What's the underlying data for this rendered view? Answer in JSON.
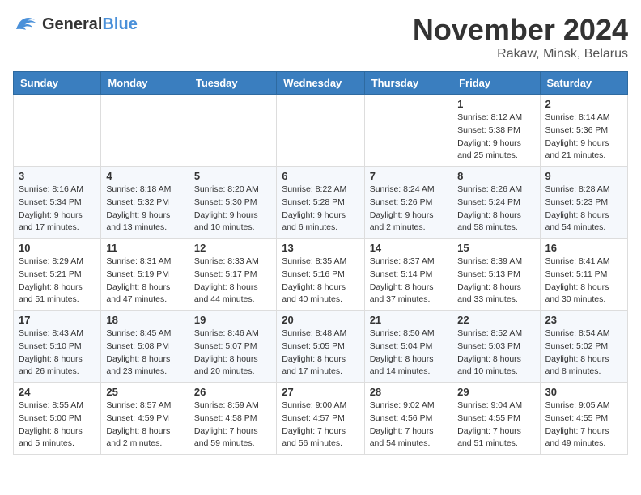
{
  "logo": {
    "text_general": "General",
    "text_blue": "Blue"
  },
  "title": "November 2024",
  "location": "Rakaw, Minsk, Belarus",
  "days_of_week": [
    "Sunday",
    "Monday",
    "Tuesday",
    "Wednesday",
    "Thursday",
    "Friday",
    "Saturday"
  ],
  "weeks": [
    [
      {
        "day": "",
        "sunrise": "",
        "sunset": "",
        "daylight": ""
      },
      {
        "day": "",
        "sunrise": "",
        "sunset": "",
        "daylight": ""
      },
      {
        "day": "",
        "sunrise": "",
        "sunset": "",
        "daylight": ""
      },
      {
        "day": "",
        "sunrise": "",
        "sunset": "",
        "daylight": ""
      },
      {
        "day": "",
        "sunrise": "",
        "sunset": "",
        "daylight": ""
      },
      {
        "day": "1",
        "sunrise": "Sunrise: 8:12 AM",
        "sunset": "Sunset: 5:38 PM",
        "daylight": "Daylight: 9 hours and 25 minutes."
      },
      {
        "day": "2",
        "sunrise": "Sunrise: 8:14 AM",
        "sunset": "Sunset: 5:36 PM",
        "daylight": "Daylight: 9 hours and 21 minutes."
      }
    ],
    [
      {
        "day": "3",
        "sunrise": "Sunrise: 8:16 AM",
        "sunset": "Sunset: 5:34 PM",
        "daylight": "Daylight: 9 hours and 17 minutes."
      },
      {
        "day": "4",
        "sunrise": "Sunrise: 8:18 AM",
        "sunset": "Sunset: 5:32 PM",
        "daylight": "Daylight: 9 hours and 13 minutes."
      },
      {
        "day": "5",
        "sunrise": "Sunrise: 8:20 AM",
        "sunset": "Sunset: 5:30 PM",
        "daylight": "Daylight: 9 hours and 10 minutes."
      },
      {
        "day": "6",
        "sunrise": "Sunrise: 8:22 AM",
        "sunset": "Sunset: 5:28 PM",
        "daylight": "Daylight: 9 hours and 6 minutes."
      },
      {
        "day": "7",
        "sunrise": "Sunrise: 8:24 AM",
        "sunset": "Sunset: 5:26 PM",
        "daylight": "Daylight: 9 hours and 2 minutes."
      },
      {
        "day": "8",
        "sunrise": "Sunrise: 8:26 AM",
        "sunset": "Sunset: 5:24 PM",
        "daylight": "Daylight: 8 hours and 58 minutes."
      },
      {
        "day": "9",
        "sunrise": "Sunrise: 8:28 AM",
        "sunset": "Sunset: 5:23 PM",
        "daylight": "Daylight: 8 hours and 54 minutes."
      }
    ],
    [
      {
        "day": "10",
        "sunrise": "Sunrise: 8:29 AM",
        "sunset": "Sunset: 5:21 PM",
        "daylight": "Daylight: 8 hours and 51 minutes."
      },
      {
        "day": "11",
        "sunrise": "Sunrise: 8:31 AM",
        "sunset": "Sunset: 5:19 PM",
        "daylight": "Daylight: 8 hours and 47 minutes."
      },
      {
        "day": "12",
        "sunrise": "Sunrise: 8:33 AM",
        "sunset": "Sunset: 5:17 PM",
        "daylight": "Daylight: 8 hours and 44 minutes."
      },
      {
        "day": "13",
        "sunrise": "Sunrise: 8:35 AM",
        "sunset": "Sunset: 5:16 PM",
        "daylight": "Daylight: 8 hours and 40 minutes."
      },
      {
        "day": "14",
        "sunrise": "Sunrise: 8:37 AM",
        "sunset": "Sunset: 5:14 PM",
        "daylight": "Daylight: 8 hours and 37 minutes."
      },
      {
        "day": "15",
        "sunrise": "Sunrise: 8:39 AM",
        "sunset": "Sunset: 5:13 PM",
        "daylight": "Daylight: 8 hours and 33 minutes."
      },
      {
        "day": "16",
        "sunrise": "Sunrise: 8:41 AM",
        "sunset": "Sunset: 5:11 PM",
        "daylight": "Daylight: 8 hours and 30 minutes."
      }
    ],
    [
      {
        "day": "17",
        "sunrise": "Sunrise: 8:43 AM",
        "sunset": "Sunset: 5:10 PM",
        "daylight": "Daylight: 8 hours and 26 minutes."
      },
      {
        "day": "18",
        "sunrise": "Sunrise: 8:45 AM",
        "sunset": "Sunset: 5:08 PM",
        "daylight": "Daylight: 8 hours and 23 minutes."
      },
      {
        "day": "19",
        "sunrise": "Sunrise: 8:46 AM",
        "sunset": "Sunset: 5:07 PM",
        "daylight": "Daylight: 8 hours and 20 minutes."
      },
      {
        "day": "20",
        "sunrise": "Sunrise: 8:48 AM",
        "sunset": "Sunset: 5:05 PM",
        "daylight": "Daylight: 8 hours and 17 minutes."
      },
      {
        "day": "21",
        "sunrise": "Sunrise: 8:50 AM",
        "sunset": "Sunset: 5:04 PM",
        "daylight": "Daylight: 8 hours and 14 minutes."
      },
      {
        "day": "22",
        "sunrise": "Sunrise: 8:52 AM",
        "sunset": "Sunset: 5:03 PM",
        "daylight": "Daylight: 8 hours and 10 minutes."
      },
      {
        "day": "23",
        "sunrise": "Sunrise: 8:54 AM",
        "sunset": "Sunset: 5:02 PM",
        "daylight": "Daylight: 8 hours and 8 minutes."
      }
    ],
    [
      {
        "day": "24",
        "sunrise": "Sunrise: 8:55 AM",
        "sunset": "Sunset: 5:00 PM",
        "daylight": "Daylight: 8 hours and 5 minutes."
      },
      {
        "day": "25",
        "sunrise": "Sunrise: 8:57 AM",
        "sunset": "Sunset: 4:59 PM",
        "daylight": "Daylight: 8 hours and 2 minutes."
      },
      {
        "day": "26",
        "sunrise": "Sunrise: 8:59 AM",
        "sunset": "Sunset: 4:58 PM",
        "daylight": "Daylight: 7 hours and 59 minutes."
      },
      {
        "day": "27",
        "sunrise": "Sunrise: 9:00 AM",
        "sunset": "Sunset: 4:57 PM",
        "daylight": "Daylight: 7 hours and 56 minutes."
      },
      {
        "day": "28",
        "sunrise": "Sunrise: 9:02 AM",
        "sunset": "Sunset: 4:56 PM",
        "daylight": "Daylight: 7 hours and 54 minutes."
      },
      {
        "day": "29",
        "sunrise": "Sunrise: 9:04 AM",
        "sunset": "Sunset: 4:55 PM",
        "daylight": "Daylight: 7 hours and 51 minutes."
      },
      {
        "day": "30",
        "sunrise": "Sunrise: 9:05 AM",
        "sunset": "Sunset: 4:55 PM",
        "daylight": "Daylight: 7 hours and 49 minutes."
      }
    ]
  ]
}
